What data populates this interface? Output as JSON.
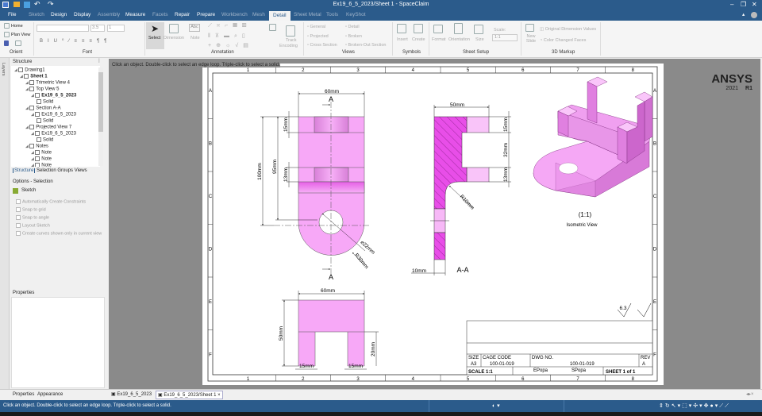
{
  "window": {
    "title": "Ex19_6_5_2023/Sheet 1 - SpaceClaim"
  },
  "menu": [
    {
      "label": "File",
      "state": "on"
    },
    {
      "label": "Sketch",
      "state": "dim"
    },
    {
      "label": "Design",
      "state": "on"
    },
    {
      "label": "Display",
      "state": "on"
    },
    {
      "label": "Assembly",
      "state": "dim"
    },
    {
      "label": "Measure",
      "state": "on"
    },
    {
      "label": "Facets",
      "state": "dim"
    },
    {
      "label": "Repair",
      "state": "on"
    },
    {
      "label": "Prepare",
      "state": "on"
    },
    {
      "label": "Workbench",
      "state": "dim"
    },
    {
      "label": "Mesh",
      "state": "dim"
    },
    {
      "label": "Detail",
      "state": "active"
    },
    {
      "label": "Sheet Metal",
      "state": "dim"
    },
    {
      "label": "Tools",
      "state": "dim"
    },
    {
      "label": "KeyShot",
      "state": "dim"
    }
  ],
  "ribbon": {
    "orient": {
      "home": "Home",
      "plan_view": "Plan View",
      "group": "Orient"
    },
    "font": {
      "size": "3.5",
      "spacing": "1",
      "group": "Font"
    },
    "annotation": {
      "select": "Select",
      "dimension": "Dimension",
      "note": "Note",
      "note_icon": "Abc",
      "group": "Annotation"
    },
    "views": {
      "track": "Track",
      "encoding": "Encoding",
      "general": "General",
      "projected": "Projected",
      "cross_section": "Cross Section",
      "detail": "Detail",
      "broken": "Broken",
      "broken_out": "Broken-Out Section",
      "group": "Views"
    },
    "symbols": {
      "insert": "Insert",
      "create": "Create",
      "group": "Symbols"
    },
    "sheet_setup": {
      "format": "Format",
      "orientation": "Orientation",
      "size": "Size",
      "scale_label": "Scale:",
      "scale_value": "1:1",
      "group": "Sheet Setup"
    },
    "markup": {
      "new_slide": "New Slide",
      "original_dims": "Original Dimension Values",
      "color_changed": "Color Changed Faces",
      "group": "3D Markup"
    }
  },
  "left_panel": {
    "layers_tab": "Layers",
    "structure_title": "Structure",
    "tree": [
      {
        "label": "Drawing1",
        "level": 0
      },
      {
        "label": "Sheet 1",
        "level": 1,
        "bold": true
      },
      {
        "label": "Trimetric View 4",
        "level": 2
      },
      {
        "label": "Top View 5",
        "level": 2
      },
      {
        "label": "Ex19_6_5_2023",
        "level": 3,
        "bold": true
      },
      {
        "label": "Solid",
        "level": 4
      },
      {
        "label": "Section A-A",
        "level": 2
      },
      {
        "label": "Ex19_6_5_2023",
        "level": 3
      },
      {
        "label": "Solid",
        "level": 4
      },
      {
        "label": "Projected View 7",
        "level": 2
      },
      {
        "label": "Ex19_6_5_2023",
        "level": 3
      },
      {
        "label": "Solid",
        "level": 4
      },
      {
        "label": "Notes",
        "level": 2
      },
      {
        "label": "Note",
        "level": 3
      },
      {
        "label": "Note",
        "level": 3
      },
      {
        "label": "Note",
        "level": 3
      }
    ],
    "tabs": [
      "Structure",
      "Selection",
      "Groups",
      "Views"
    ],
    "options_title": "Options - Selection",
    "sketch": "Sketch",
    "options": [
      {
        "label": "Automatically Create Constraints",
        "checked": true
      },
      {
        "label": "Snap to grid",
        "checked": false
      },
      {
        "label": "Snap to angle",
        "checked": false
      },
      {
        "label": "Layout Sketch",
        "checked": false
      },
      {
        "label": "Create curves shown only in current view",
        "checked": false
      }
    ],
    "properties_title": "Properties",
    "bottom_tabs": [
      "Properties",
      "Appearance"
    ]
  },
  "canvas": {
    "hint": "Click an object. Double-click to select an edge loop. Triple-click to select a solid.",
    "brand": "ANSYS",
    "version": "2021",
    "release": "R1"
  },
  "sheet": {
    "columns": [
      "1",
      "2",
      "3",
      "4",
      "5",
      "6",
      "7",
      "8"
    ],
    "rows": [
      "A",
      "B",
      "C",
      "D",
      "E",
      "F"
    ],
    "top_view": {
      "width": "60mm",
      "h100": "100mm",
      "h95": "95mm",
      "h15": "15mm",
      "h13": "13mm",
      "dia": "⌀22mm",
      "radius": "R30mm",
      "section_mark": "A"
    },
    "section_view": {
      "width": "50mm",
      "d15": "15mm",
      "d32": "32mm",
      "d13": "13mm",
      "radius": "R10mm",
      "thickness": "10mm",
      "label": "A-A"
    },
    "iso_view": {
      "scale": "(1:1)",
      "label": "Isometric View"
    },
    "projected_view": {
      "width": "60mm",
      "height": "50mm",
      "notch": "20mm",
      "left": "15mm",
      "right": "15mm"
    },
    "surface_finish": "6.3",
    "title_block": {
      "size_label": "SIZE",
      "size": "A3",
      "cage_label": "CAGE CODE",
      "cage": "100-01-019",
      "dwg_label": "DWG NO.",
      "dwg": "100-01-019",
      "rev_label": "REV",
      "rev": "A",
      "scale": "SCALE  1:1",
      "drawn": "EPopa",
      "checked": "SPopa",
      "sheet": "SHEET  1 of 1"
    }
  },
  "doc_tabs": [
    {
      "label": "Ex19_6_5_2023",
      "active": false
    },
    {
      "label": "Ex19_6_5_2023/Sheet 1",
      "active": true
    }
  ],
  "status": {
    "text": "Click an object. Double-click to select an edge loop. Triple-click to select a solid."
  },
  "colors": {
    "chrome": "#2b5b8b",
    "part": "#f7a8f7",
    "hatch": "#e84ee8",
    "canvas": "#8a8a8a"
  }
}
